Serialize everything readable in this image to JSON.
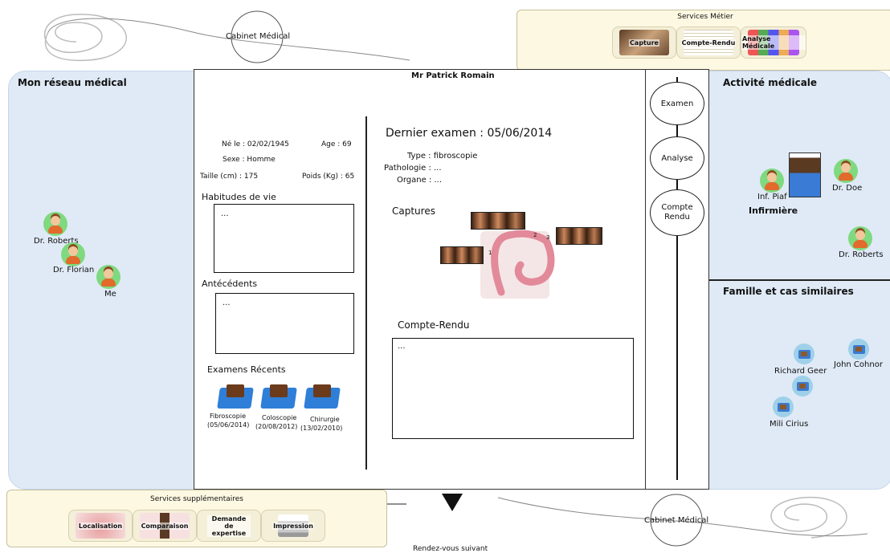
{
  "top": {
    "cabinet_label": "Cabinet Médical"
  },
  "services_metier": {
    "title": "Services Métier",
    "buttons": [
      "Capture",
      "Compte-Rendu",
      "Analyse Médicale"
    ]
  },
  "patient": {
    "name": "Mr Patrick Romain",
    "born": "Né le : 02/02/1945",
    "age": "Age : 69",
    "sex": "Sexe : Homme",
    "height": "Taille (cm) : 175",
    "weight": "Poids (Kg) : 65"
  },
  "habits": {
    "label": "Habitudes de vie",
    "value": "..."
  },
  "antecedents": {
    "label": "Antécédents",
    "value": "..."
  },
  "recent_exams": {
    "label": "Examens Récents",
    "items": [
      {
        "name": "Fibroscopie",
        "date": "(05/06/2014)"
      },
      {
        "name": "Coloscopie",
        "date": "(20/08/2012)"
      },
      {
        "name": "Chirurgie",
        "date": "(13/02/2010)"
      }
    ]
  },
  "exam": {
    "title": "Dernier examen : 05/06/2014",
    "type": "Type : fibroscopie",
    "pathologie": "Pathologie : ...",
    "organe": "Organe : ...",
    "captures_label": "Captures",
    "capture_numbers": [
      "1",
      "2",
      "3"
    ],
    "report_label": "Compte-Rendu",
    "report_value": "..."
  },
  "nav": {
    "items": [
      "Examen",
      "Analyse",
      "Compte\nRendu"
    ]
  },
  "network": {
    "title": "Mon réseau médical",
    "people": [
      "Dr. Roberts",
      "Dr. Florian",
      "Me"
    ]
  },
  "activity": {
    "title": "Activité médicale",
    "people": [
      "Inf. Piaf",
      "Dr. Doe",
      "Dr. Roberts"
    ],
    "nurse_label": "Infirmière"
  },
  "family": {
    "title": "Famille et cas similaires",
    "people": [
      "Richard Geer",
      "John Cohnor",
      "Mili Cirius"
    ]
  },
  "services_supp": {
    "title": "Services supplémentaires",
    "buttons": [
      "Localisation",
      "Comparaison",
      "Demande de expertise",
      "Impression"
    ]
  },
  "bottom": {
    "next_label": "Rendez-vous suivant",
    "cabinet_label": "Cabinet Médical"
  }
}
